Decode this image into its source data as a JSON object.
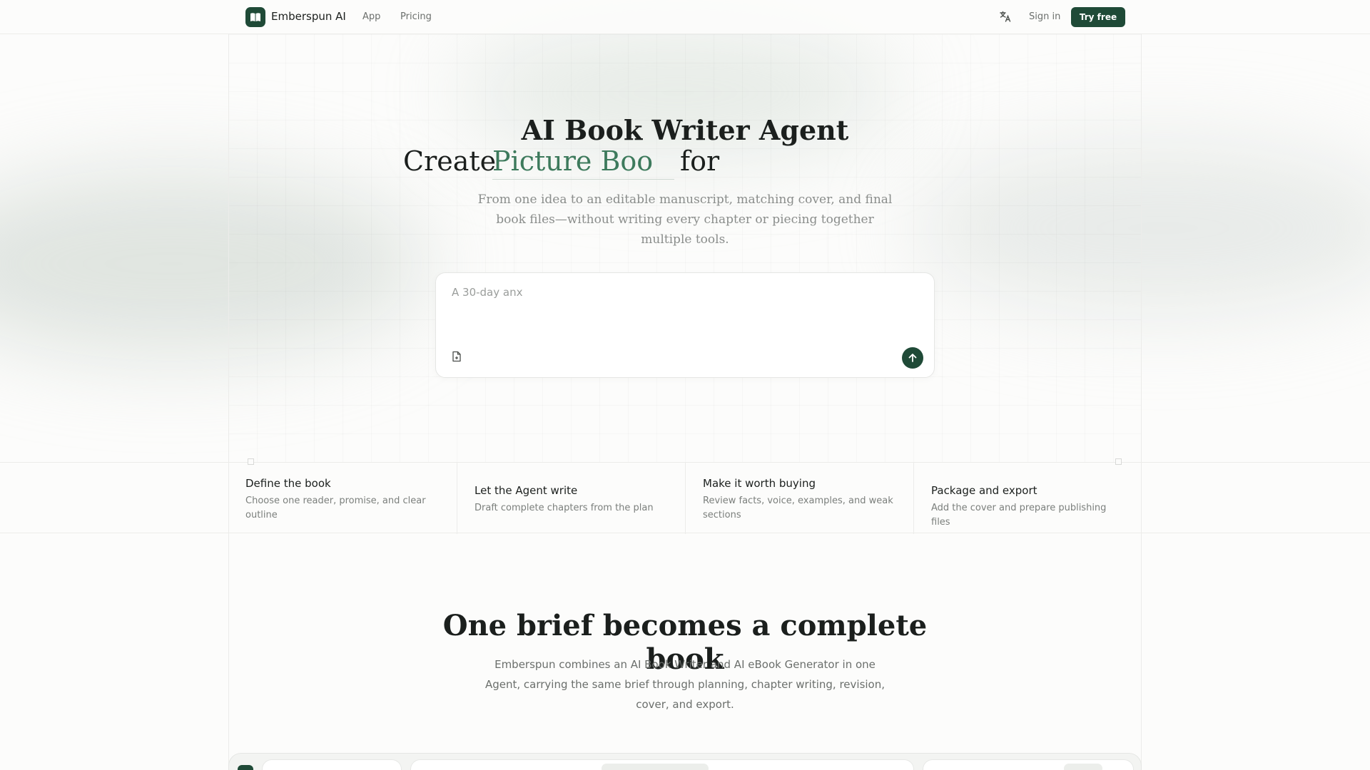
{
  "header": {
    "brand": "Emberspun AI",
    "nav": [
      {
        "label": "App"
      },
      {
        "label": "Pricing"
      }
    ],
    "sign_in": "Sign in",
    "try_free": "Try free",
    "icons": {
      "logo": "open-book-icon",
      "translate": "translate-icon"
    }
  },
  "hero": {
    "title": "AI Book Writer Agent",
    "line2_prefix": "Create",
    "typed_text": "Picture Boo",
    "line2_suffix": "for",
    "subtitle": "From one idea to an editable manuscript, matching cover, and final book files—without writing every chapter or piecing together multiple tools."
  },
  "prompt": {
    "placeholder": "A 30-day anx",
    "value": "",
    "icons": {
      "attach": "file-attach-icon",
      "send": "arrow-up-icon"
    }
  },
  "steps": [
    {
      "title": "Define the book",
      "desc": "Choose one reader, promise, and clear outline"
    },
    {
      "title": "Let the Agent write",
      "desc": "Draft complete chapters from the plan"
    },
    {
      "title": "Make it worth buying",
      "desc": "Review facts, voice, examples, and weak sections"
    },
    {
      "title": "Package and export",
      "desc": "Add the cover and prepare publishing files"
    }
  ],
  "section": {
    "title": "One brief becomes a complete book",
    "subtitle": "Emberspun combines an AI Book Writer and AI eBook Generator in one Agent, carrying the same brief through planning, chapter writing, revision, cover, and export."
  },
  "colors": {
    "accent": "#1f4a37",
    "accent_text": "#3d7a5c",
    "muted": "#6b6f6c"
  }
}
